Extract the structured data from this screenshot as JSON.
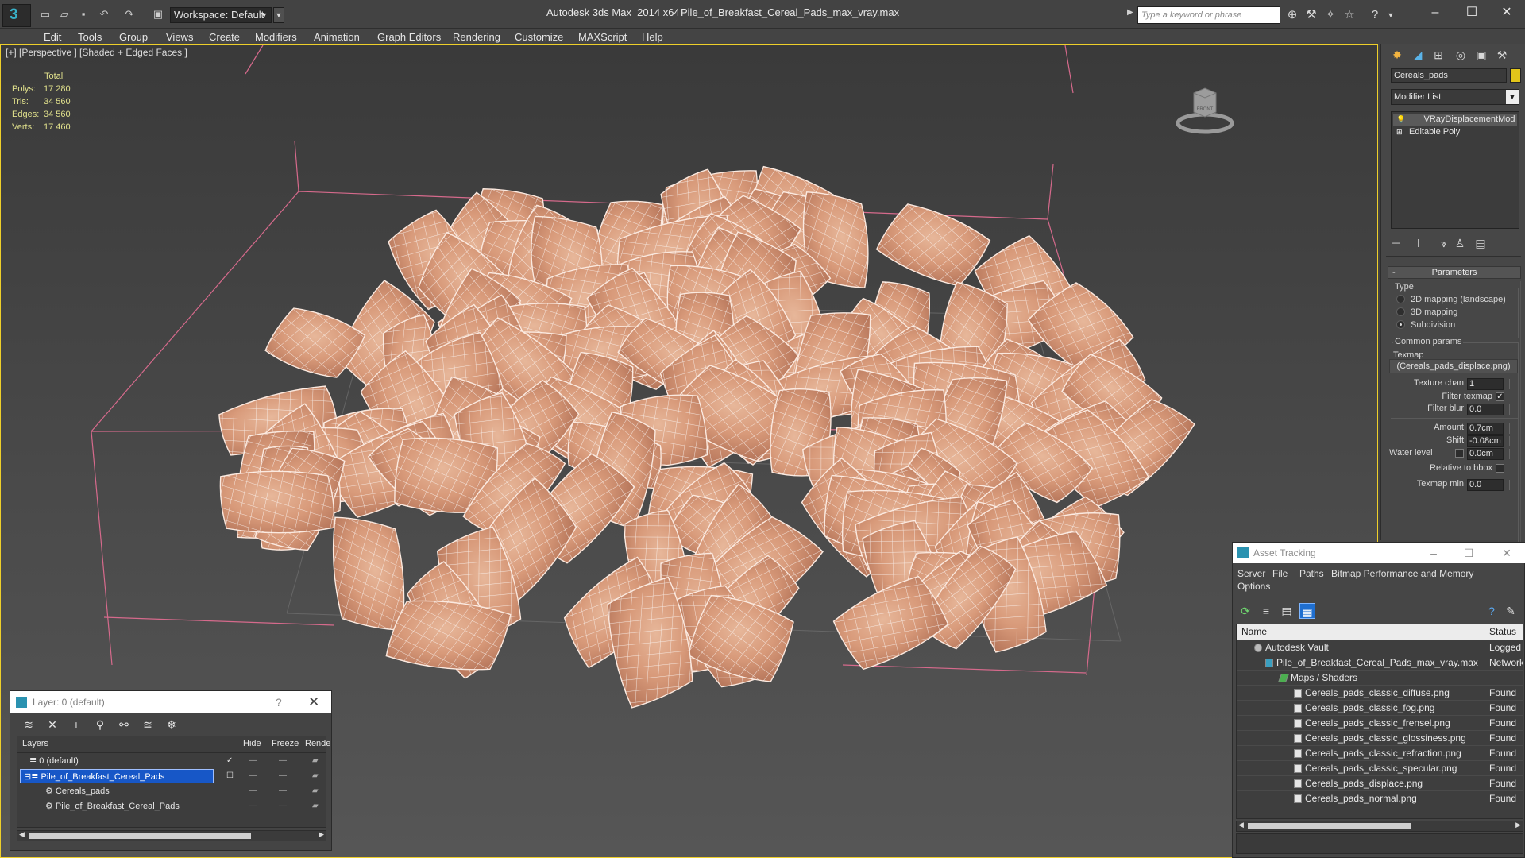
{
  "titlebar": {
    "app_title": "Autodesk 3ds Max  2014 x64",
    "file_title": "Pile_of_Breakfast_Cereal_Pads_max_vray.max",
    "workspace": "Workspace: Default",
    "search_placeholder": "Type a keyword or phrase"
  },
  "menu": [
    "Edit",
    "Tools",
    "Group",
    "Views",
    "Create",
    "Modifiers",
    "Animation",
    "Graph Editors",
    "Rendering",
    "Customize",
    "MAXScript",
    "Help"
  ],
  "viewport": {
    "label": "[+] [Perspective ] [Shaded + Edged Faces ]",
    "stats": {
      "header": "Total",
      "rows": [
        {
          "label": "Polys:",
          "value": "17 280"
        },
        {
          "label": "Tris:",
          "value": "34 560"
        },
        {
          "label": "Edges:",
          "value": "34 560"
        },
        {
          "label": "Verts:",
          "value": "17 460"
        }
      ]
    },
    "viewcube_label": "FRONT"
  },
  "command_panel": {
    "object_name": "Cereals_pads",
    "object_color": "#e2c51a",
    "modifier_list": "Modifier List",
    "stack": [
      "VRayDisplacementMod",
      "Editable Poly"
    ],
    "rollout": "Parameters",
    "type_group": "Type",
    "type_options": [
      "2D mapping (landscape)",
      "3D mapping",
      "Subdivision"
    ],
    "type_selected": 2,
    "common_group": "Common params",
    "texmap_label": "Texmap",
    "texmap_value": "(Cereals_pads_displace.png)",
    "texture_chan_label": "Texture chan",
    "texture_chan_value": "1",
    "filter_texmap_label": "Filter texmap",
    "filter_texmap_checked": true,
    "filter_blur_label": "Filter blur",
    "filter_blur_value": "0.0",
    "amount_label": "Amount",
    "amount_value": "0.7cm",
    "shift_label": "Shift",
    "shift_value": "-0.08cm",
    "water_level_label": "Water level",
    "water_level_value": "0.0cm",
    "relative_label": "Relative to bbox",
    "texmap_min_label": "Texmap min",
    "texmap_min_value": "0.0"
  },
  "layer_dialog": {
    "title": "Layer: 0 (default)",
    "help": "?",
    "columns": [
      "Layers",
      "Hide",
      "Freeze",
      "Rende"
    ],
    "rows": [
      "0 (default)",
      "Pile_of_Breakfast_Cereal_Pads",
      "Cereals_pads",
      "Pile_of_Breakfast_Cereal_Pads"
    ]
  },
  "asset_tracking": {
    "title": "Asset Tracking",
    "menu": [
      "Server",
      "File",
      "Paths",
      "Bitmap Performance and Memory",
      "Options"
    ],
    "columns": {
      "name": "Name",
      "status": "Status"
    },
    "rows": [
      {
        "name": "Autodesk Vault",
        "status": "Logged O"
      },
      {
        "name": "Pile_of_Breakfast_Cereal_Pads_max_vray.max",
        "status": "Network"
      },
      {
        "name": "Maps / Shaders",
        "status": ""
      },
      {
        "name": "Cereals_pads_classic_diffuse.png",
        "status": "Found"
      },
      {
        "name": "Cereals_pads_classic_fog.png",
        "status": "Found"
      },
      {
        "name": "Cereals_pads_classic_frensel.png",
        "status": "Found"
      },
      {
        "name": "Cereals_pads_classic_glossiness.png",
        "status": "Found"
      },
      {
        "name": "Cereals_pads_classic_refraction.png",
        "status": "Found"
      },
      {
        "name": "Cereals_pads_classic_specular.png",
        "status": "Found"
      },
      {
        "name": "Cereals_pads_displace.png",
        "status": "Found"
      },
      {
        "name": "Cereals_pads_normal.png",
        "status": "Found"
      }
    ]
  }
}
